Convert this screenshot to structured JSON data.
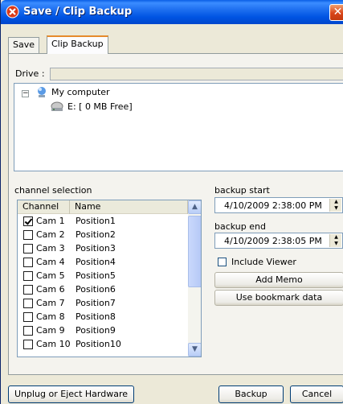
{
  "window": {
    "title": "Save / Clip Backup",
    "close_glyph": "✕"
  },
  "tabs": [
    {
      "label": "Save"
    },
    {
      "label": "Clip Backup"
    }
  ],
  "drive": {
    "label": "Drive :",
    "value": "",
    "tree": [
      {
        "label": "My computer",
        "icon": "computer-icon",
        "expander": "⊟"
      },
      {
        "label": "E: [ 0 MB Free]",
        "icon": "drive-icon"
      }
    ]
  },
  "channels": {
    "label": "channel selection",
    "columns": [
      "Channel",
      "Name"
    ],
    "rows": [
      {
        "channel": "Cam 1",
        "name": "Position1",
        "checked": true
      },
      {
        "channel": "Cam 2",
        "name": "Position2",
        "checked": false
      },
      {
        "channel": "Cam 3",
        "name": "Position3",
        "checked": false
      },
      {
        "channel": "Cam 4",
        "name": "Position4",
        "checked": false
      },
      {
        "channel": "Cam 5",
        "name": "Position5",
        "checked": false
      },
      {
        "channel": "Cam 6",
        "name": "Position6",
        "checked": false
      },
      {
        "channel": "Cam 7",
        "name": "Position7",
        "checked": false
      },
      {
        "channel": "Cam 8",
        "name": "Position8",
        "checked": false
      },
      {
        "channel": "Cam 9",
        "name": "Position9",
        "checked": false
      },
      {
        "channel": "Cam 10",
        "name": "Position10",
        "checked": false
      }
    ]
  },
  "backup_start": {
    "label": "backup start",
    "value": "4/10/2009   2:38:00 PM"
  },
  "backup_end": {
    "label": "backup end",
    "value": "4/10/2009   2:38:05 PM"
  },
  "include_viewer": {
    "label": "Include Viewer",
    "checked": false
  },
  "buttons": {
    "add_memo": "Add Memo",
    "use_bookmark": "Use bookmark data",
    "unplug": "Unplug or Eject Hardware",
    "backup": "Backup",
    "cancel": "Cancel"
  }
}
